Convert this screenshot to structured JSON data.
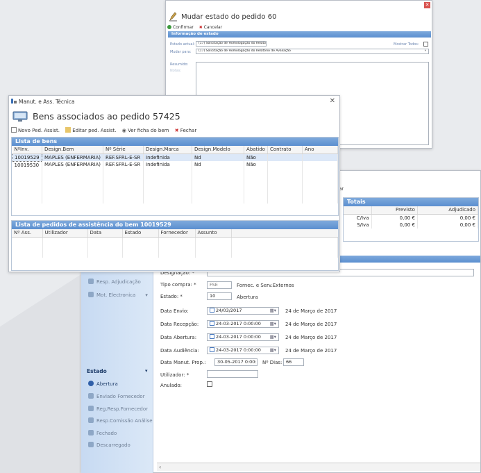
{
  "win_state": {
    "title": "Mudar estado do pedido 60",
    "toolbar": {
      "confirm": "Confirmar",
      "cancel": "Cancelar"
    },
    "section": "Informação de estado",
    "current_state_label": "Estado actual:",
    "current_state_value": "(17) Solicitação de Homologação do Relatório de Ava...",
    "change_to_label": "Mudar para:",
    "change_to_value": "(17) Solicitação de Homologação do Relatório de Avaliação",
    "show_all_label": "Mostrar Todos:",
    "summary_label": "Resumido:",
    "notes_label": "Notas:"
  },
  "win_goods": {
    "window_title": "Manut. e Ass. Técnica",
    "title": "Bens associados ao pedido 57425",
    "toolbar": {
      "new": "Novo Ped. Assist.",
      "edit": "Editar ped. Assist.",
      "view": "Ver ficha do bem",
      "close": "Fechar"
    },
    "list_title": "Lista de bens",
    "columns": [
      "NºInv.",
      "Design.Bem",
      "Nº Série",
      "Design.Marca",
      "Design.Modelo",
      "Abatido",
      "Contrato",
      "Ano"
    ],
    "rows": [
      [
        "10019529",
        "MAPLES (ENFERMARIA)",
        "REF.SFRL-E-SR",
        "Indefinida",
        "Nd",
        "Não",
        "",
        ""
      ],
      [
        "10019530",
        "MAPLES (ENFERMARIA)",
        "REF.SFRL-E-SR",
        "Indefinida",
        "Nd",
        "Não",
        "",
        ""
      ]
    ],
    "requests_title": "Lista de pedidos de assistência do bem 10019529",
    "requests_columns": [
      "Nº Ass.",
      "Utilizador",
      "Data",
      "Estado",
      "Fornecedor",
      "Assunto"
    ]
  },
  "win_detail": {
    "totals": {
      "title": "Totais",
      "columns": [
        "",
        "Previsto",
        "Adjudicado"
      ],
      "rows": [
        [
          "C/Iva",
          "0,00 €",
          "0,00 €"
        ],
        [
          "S/Iva",
          "0,00 €",
          "0,00 €"
        ]
      ]
    },
    "sidebar_top": [
      "Resp. Adjudicação",
      "Mot. Electronica"
    ],
    "sidebar_section": "Estado",
    "sidebar_states": [
      "Abertura",
      "Enviado Fornecedor",
      "Reg.Resp.Fornecedor",
      "Resp.Comissão Análise",
      "Fechado",
      "Descarregado"
    ],
    "form": {
      "designacao_label": "Designação: *",
      "tipo_label": "Tipo compra: *",
      "tipo_code": "FSE",
      "tipo_text": "Fornec. e Serv.Externos",
      "estado_label": "Estado: *",
      "estado_code": "10",
      "estado_text": "Abertura",
      "envio_label": "Data Envio:",
      "envio_value": "24/03/2017",
      "envio_long": "24 de Março de 2017",
      "recepcao_label": "Data Recepção:",
      "recepcao_value": "24-03-2017 0:00:00",
      "recepcao_long": "24 de Março de 2017",
      "abertura_label": "Data Abertura:",
      "abertura_value": "24-03-2017 0:00:00",
      "abertura_long": "24 de Março de 2017",
      "audiencia_label": "Data Audiência:",
      "audiencia_value": "24-03-2017 0:00:00",
      "audiencia_long": "24 de Março de 2017",
      "manut_label": "Data Manut. Prop.:",
      "manut_value": "30-05-2017 0:00:00",
      "dias_label": "Nº Dias:",
      "dias_value": "66",
      "utilizador_label": "Utilizador: *",
      "anulado_label": "Anulado:"
    },
    "fragment_text": "ar"
  }
}
